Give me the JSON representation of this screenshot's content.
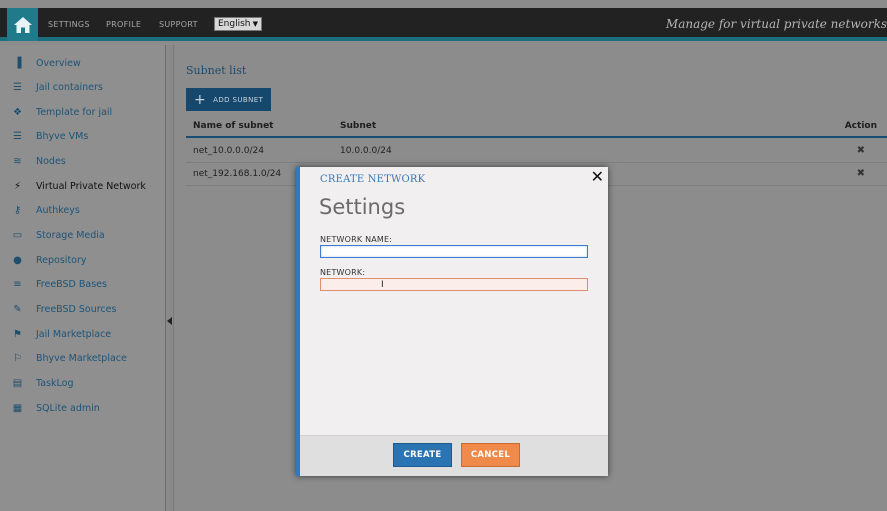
{
  "topbar": {
    "nav": [
      "SETTINGS",
      "PROFILE",
      "SUPPORT"
    ],
    "language": "English",
    "tagline": "Manage for virtual private networks"
  },
  "sidebar": {
    "items": [
      {
        "label": "Overview",
        "icon": "bar-chart-icon"
      },
      {
        "label": "Jail containers",
        "icon": "list-icon"
      },
      {
        "label": "Template for jail",
        "icon": "cubes-icon"
      },
      {
        "label": "Bhyve VMs",
        "icon": "list-icon"
      },
      {
        "label": "Nodes",
        "icon": "layers-icon"
      },
      {
        "label": "Virtual Private Network",
        "icon": "plug-icon",
        "active": true
      },
      {
        "label": "Authkeys",
        "icon": "key-icon"
      },
      {
        "label": "Storage Media",
        "icon": "drive-icon"
      },
      {
        "label": "Repository",
        "icon": "globe-icon"
      },
      {
        "label": "FreeBSD Bases",
        "icon": "database-icon"
      },
      {
        "label": "FreeBSD Sources",
        "icon": "edit-icon"
      },
      {
        "label": "Jail Marketplace",
        "icon": "flag-icon"
      },
      {
        "label": "Bhyve Marketplace",
        "icon": "flag-icon"
      },
      {
        "label": "TaskLog",
        "icon": "terminal-icon"
      },
      {
        "label": "SQLite admin",
        "icon": "table-icon"
      }
    ]
  },
  "main": {
    "title": "Subnet list",
    "add_button": "ADD SUBNET",
    "columns": [
      "Name of subnet",
      "Subnet",
      "Action"
    ],
    "rows": [
      {
        "name": "net_10.0.0.0/24",
        "subnet": "10.0.0.0/24"
      },
      {
        "name": "net_192.168.1.0/24",
        "subnet": ""
      }
    ]
  },
  "modal": {
    "kicker": "CREATE NETWORK",
    "title": "Settings",
    "fields": [
      {
        "label": "NETWORK NAME:",
        "value": ""
      },
      {
        "label": "NETWORK:",
        "value": ""
      }
    ],
    "create_label": "CREATE",
    "cancel_label": "CANCEL"
  },
  "colors": {
    "accent": "#2a74b4",
    "cancel": "#f08a4a",
    "topbar": "#222222",
    "teal": "#1f7a8a"
  }
}
